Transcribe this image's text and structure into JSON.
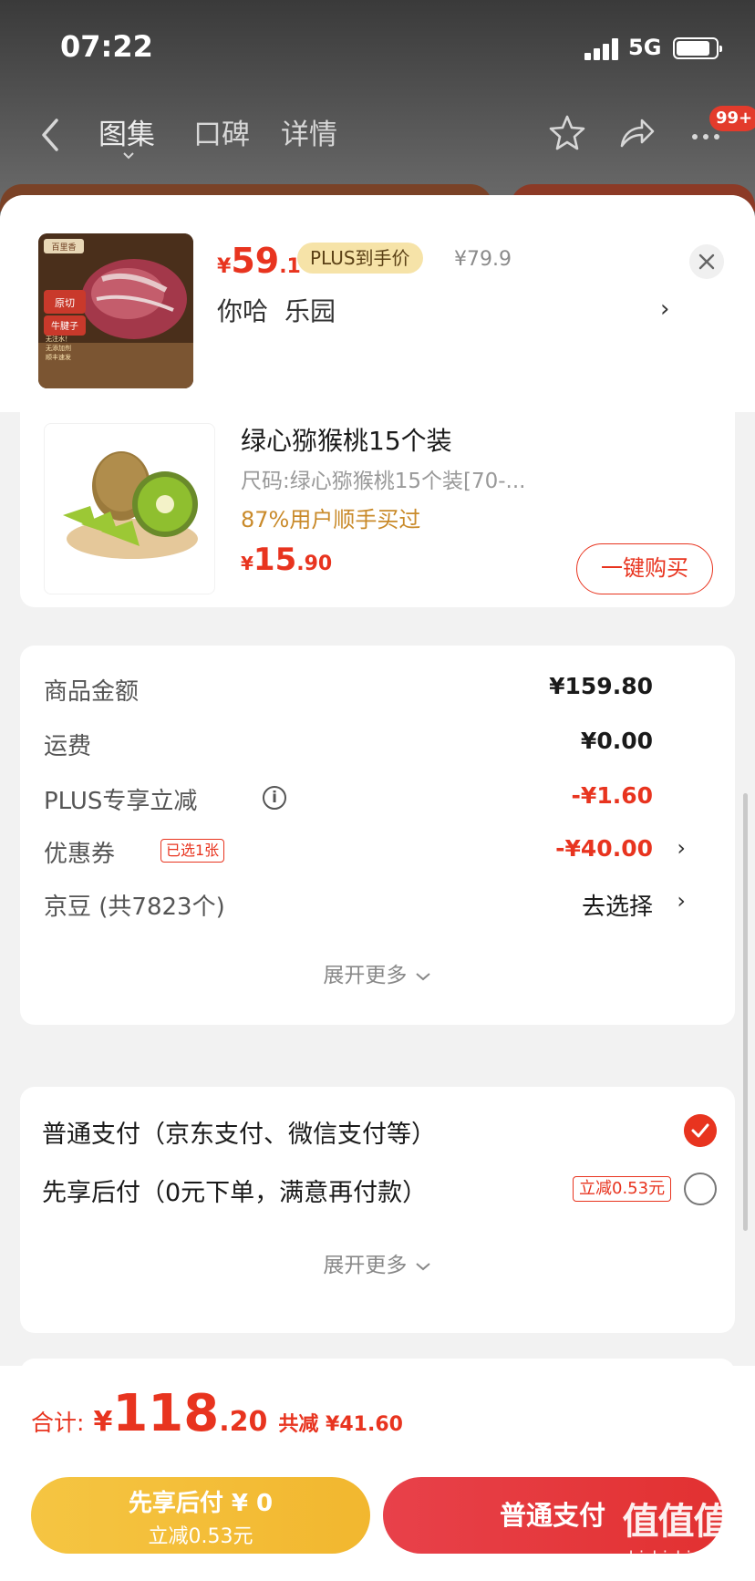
{
  "status_bar": {
    "time": "07:22",
    "network": "5G"
  },
  "nav": {
    "tabs": [
      "图集",
      "口碑",
      "详情"
    ],
    "cart_badge": "99+"
  },
  "header_product": {
    "price_yen": "¥",
    "price_int": "59",
    "price_dec": ".1",
    "plus_tag": "PLUS到手价",
    "original_price": "¥79.9",
    "spec_1": "你哈",
    "spec_2": "乐园",
    "image_brand": "百里香",
    "image_label_1": "原切",
    "image_label_2": "牛腱子",
    "image_features": [
      "无注水！",
      "无添加剂",
      "顺丰速发"
    ]
  },
  "recommend_product": {
    "title": "绿心猕猴桃15个装",
    "spec": "尺码:绿心猕猴桃15个装[70-...",
    "bought": "87%用户顺手买过",
    "price_yen": "¥",
    "price_int": "15",
    "price_dec": ".90",
    "buy_label": "一键购买"
  },
  "amount": {
    "goods_label": "商品金额",
    "goods_value": "¥159.80",
    "shipping_label": "运费",
    "shipping_value": "¥0.00",
    "plus_label": "PLUS专享立减",
    "plus_value": "-¥1.60",
    "coupon_label": "优惠券",
    "coupon_tag": "已选1张",
    "coupon_value": "-¥40.00",
    "jingdou_label": "京豆 (共7823个)",
    "jingdou_value": "去选择",
    "expand_label": "展开更多"
  },
  "payment": {
    "normal_label": "普通支付（京东支付、微信支付等）",
    "later_label": "先享后付（0元下单，满意再付款）",
    "later_tag": "立减0.53元",
    "expand_label": "展开更多"
  },
  "bottom_bar": {
    "total_label": "合计:",
    "total_yen": "¥",
    "total_int": "118",
    "total_dec": ".20",
    "total_save": "共减 ¥41.60",
    "later_btn_line1": "先享后付 ¥ 0",
    "later_btn_line2": "立减0.53元",
    "normal_btn": "普通支付"
  },
  "watermark": {
    "main": "值值值",
    "sub": "zhizhizhi.com"
  },
  "colors": {
    "accent_red": "#e8341f",
    "plus_gold": "#f6e3a8",
    "later_yellow": "#f5c542"
  }
}
